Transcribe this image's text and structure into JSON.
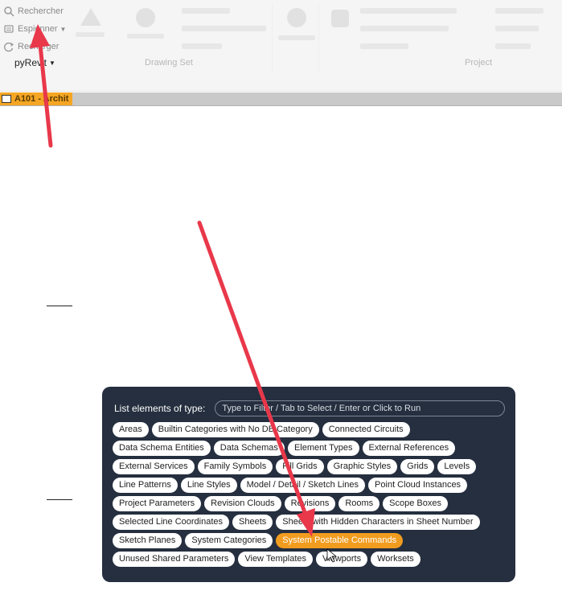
{
  "ribbon": {
    "items": [
      {
        "label": "Rechercher",
        "icon": "search-icon"
      },
      {
        "label": "Espionner",
        "icon": "spy-icon"
      },
      {
        "label": "Recharger",
        "icon": "reload-icon"
      }
    ],
    "pyrevit_label": "pyRevit",
    "panels": [
      "Drawing Set",
      "Project"
    ]
  },
  "view_tab": {
    "label": "A101 - Archit"
  },
  "panel": {
    "title": "List elements of type:",
    "search_placeholder": "Type to Filter / Tab to Select / Enter or Click to Run",
    "chips": [
      "Areas",
      "Builtin Categories with No DB Category",
      "Connected Circuits",
      "Data Schema Entities",
      "Data Schemas",
      "Element Types",
      "External References",
      "External Services",
      "Family Symbols",
      "Fill Grids",
      "Graphic Styles",
      "Grids",
      "Levels",
      "Line Patterns",
      "Line Styles",
      "Model / Detail / Sketch Lines",
      "Point Cloud Instances",
      "Project Parameters",
      "Revision Clouds",
      "Revisions",
      "Rooms",
      "Scope Boxes",
      "Selected Line Coordinates",
      "Sheets",
      "Sheets with Hidden Characters in Sheet Number",
      "Sketch Planes",
      "System Categories",
      "System Postable Commands",
      "Unused Shared Parameters",
      "View Templates",
      "Viewports",
      "Worksets"
    ],
    "active_chip": "System Postable Commands"
  },
  "colors": {
    "panel_bg": "#252f3f",
    "active_chip": "#f29c1f",
    "arrow": "#e8384a",
    "view_tab": "#f5a623"
  }
}
